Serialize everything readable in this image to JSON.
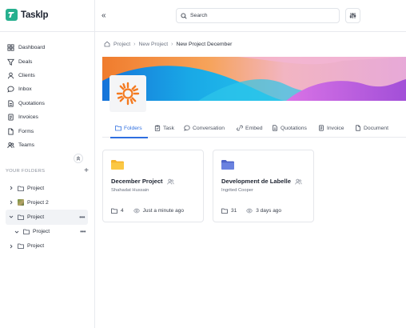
{
  "app": {
    "name": "Tasklp",
    "brand_color": "#27b08f"
  },
  "sidebar": {
    "nav": [
      {
        "label": "Dashboard",
        "icon": "dashboard-icon"
      },
      {
        "label": "Deals",
        "icon": "filter-icon"
      },
      {
        "label": "Clients",
        "icon": "user-icon"
      },
      {
        "label": "Inbox",
        "icon": "chat-icon"
      },
      {
        "label": "Quotations",
        "icon": "document-icon"
      },
      {
        "label": "Invoices",
        "icon": "invoice-icon"
      },
      {
        "label": "Forms",
        "icon": "form-icon"
      },
      {
        "label": "Teams",
        "icon": "team-icon"
      }
    ],
    "folders_title": "YOUR FOLDERS",
    "add_label": "+",
    "tree": [
      {
        "label": "Project",
        "expanded": false,
        "icon": "folder-icon"
      },
      {
        "label": "Project 2",
        "expanded": false,
        "icon": "image-thumbnail"
      },
      {
        "label": "Project",
        "expanded": true,
        "active": true,
        "icon": "folder-icon"
      },
      {
        "label": "Project",
        "expanded": true,
        "indent": 1,
        "icon": "folder-icon"
      },
      {
        "label": "Project",
        "expanded": false,
        "icon": "folder-icon"
      }
    ]
  },
  "header": {
    "collapse_label": "«",
    "search": {
      "placeholder": "Search"
    }
  },
  "breadcrumb": {
    "items": [
      "Project",
      "New Project"
    ],
    "current": "New Project December"
  },
  "tabs": [
    {
      "label": "Folders",
      "icon": "folder-icon",
      "active": true
    },
    {
      "label": "Task",
      "icon": "clipboard-icon"
    },
    {
      "label": "Conversation",
      "icon": "chat-icon"
    },
    {
      "label": "Embed",
      "icon": "link-icon"
    },
    {
      "label": "Quotations",
      "icon": "document-icon"
    },
    {
      "label": "Invoice",
      "icon": "invoice-icon"
    },
    {
      "label": "Document",
      "icon": "file-icon"
    }
  ],
  "cards": [
    {
      "title": "December Project",
      "owner": "Shahadat Hussain",
      "count": "4",
      "time": "Just a minute ago",
      "folder_color": "#f6b42c"
    },
    {
      "title": "Development de Labelle",
      "owner": "Ingrited Cooper",
      "count": "31",
      "time": "3 days ago",
      "folder_color": "#5b74d6"
    }
  ],
  "colors": {
    "accent": "#2f6fe0",
    "logo_orange": "#f47a20"
  }
}
